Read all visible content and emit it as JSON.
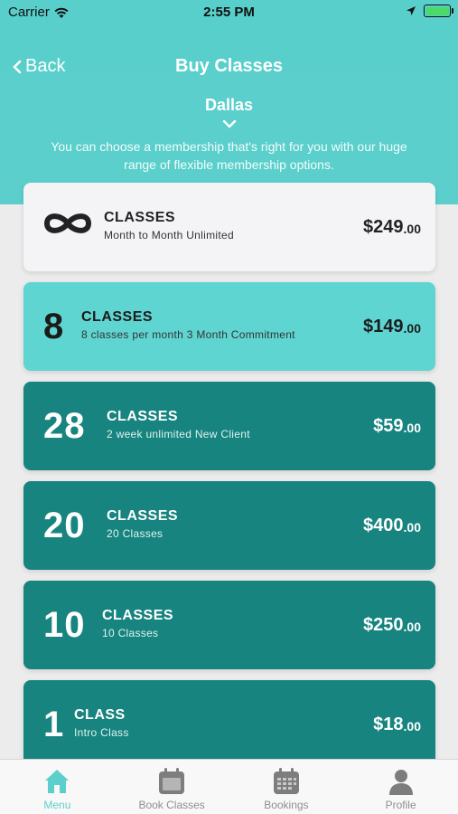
{
  "status_bar": {
    "carrier": "Carrier",
    "time": "2:55 PM"
  },
  "nav": {
    "back_label": "Back",
    "title": "Buy Classes"
  },
  "location": {
    "name": "Dallas"
  },
  "subtitle": "You can choose a membership that's right for you with our huge range of flexible membership options.",
  "colors": {
    "header": "#5ccfcc",
    "card_white": "#f4f4f6",
    "card_light": "#5fd5d2",
    "card_dark": "#17847f",
    "tab_active": "#5ccfcc",
    "battery": "#4cd964"
  },
  "cards": [
    {
      "count": "∞",
      "icon": "infinity-icon",
      "kind": "CLASSES",
      "desc": "Month to Month Unlimited",
      "price": "$249",
      "cents": ".00"
    },
    {
      "count": "8",
      "kind": "CLASSES",
      "desc": "8 classes per month 3 Month Commitment",
      "price": "$149",
      "cents": ".00"
    },
    {
      "count": "28",
      "kind": "CLASSES",
      "desc": "2 week unlimited New Client",
      "price": "$59",
      "cents": ".00"
    },
    {
      "count": "20",
      "kind": "CLASSES",
      "desc": "20 Classes",
      "price": "$400",
      "cents": ".00"
    },
    {
      "count": "10",
      "kind": "CLASSES",
      "desc": "10 Classes",
      "price": "$250",
      "cents": ".00"
    },
    {
      "count": "1",
      "kind": "CLASS",
      "desc": "Intro Class",
      "price": "$18",
      "cents": ".00"
    }
  ],
  "tabs": [
    {
      "label": "Menu",
      "icon": "home-icon",
      "active": true
    },
    {
      "label": "Book Classes",
      "icon": "calendar-icon"
    },
    {
      "label": "Bookings",
      "icon": "calendar-grid-icon"
    },
    {
      "label": "Profile",
      "icon": "person-icon"
    }
  ]
}
